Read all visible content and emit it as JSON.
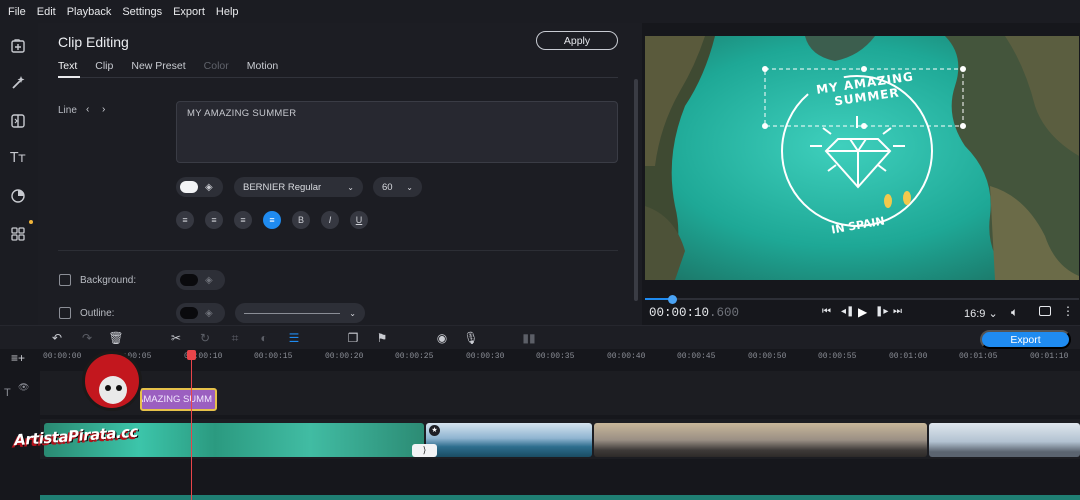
{
  "menu": [
    "File",
    "Edit",
    "Playback",
    "Settings",
    "Export",
    "Help"
  ],
  "left_icons": [
    "import-icon",
    "magic-wand-icon",
    "transitions-icon",
    "titles-icon",
    "stickers-icon",
    "more-tools-icon"
  ],
  "panel": {
    "title": "Clip Editing",
    "apply": "Apply",
    "tabs": [
      {
        "label": "Text",
        "state": "active"
      },
      {
        "label": "Clip",
        "state": "normal"
      },
      {
        "label": "New Preset",
        "state": "normal"
      },
      {
        "label": "Color",
        "state": "disabled"
      },
      {
        "label": "Motion",
        "state": "normal"
      }
    ],
    "line_label": "Line",
    "text_value": "MY AMAZING SUMMER",
    "font": "BERNIER Regular",
    "size": "60",
    "format_buttons": [
      "align-left",
      "align-right",
      "justify",
      "align-center",
      "B",
      "I",
      "U"
    ],
    "active_format": "align-center",
    "background_label": "Background:",
    "outline_label": "Outline:"
  },
  "preview": {
    "overlay_top": "MY AMAZING SUMMER",
    "overlay_bottom": "IN SPAIN",
    "time_main": "00:00:10",
    "time_frac": ".600",
    "aspect": "16:9",
    "progress": 0.07
  },
  "toolbar": {
    "export": "Export"
  },
  "ruler": [
    "00:00:00",
    "00:00:05",
    "00:00:10",
    "00:00:15",
    "00:00:20",
    "00:00:25",
    "00:00:30",
    "00:00:35",
    "00:00:40",
    "00:00:45",
    "00:00:50",
    "00:00:55",
    "00:01:00",
    "00:01:05",
    "00:01:10"
  ],
  "title_clip": "MY AMAZING SUMM",
  "watermark": "ArtistaPirata.cc",
  "colors": {
    "accent": "#1f8bf0",
    "playhead": "#e8454a",
    "title_clip": "#9b5fc0"
  }
}
